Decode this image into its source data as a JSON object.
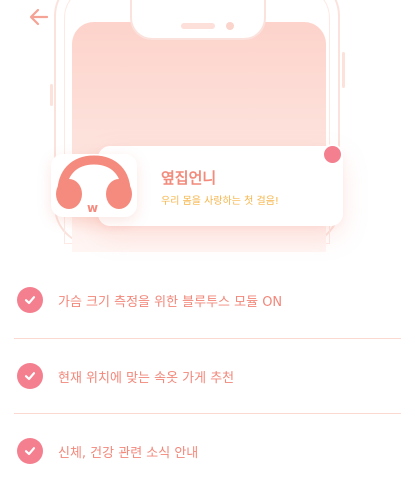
{
  "header": {
    "back_icon": "arrow-left-icon"
  },
  "app_card": {
    "title": "옆집언니",
    "subtitle": "우리 몸을 사랑하는 첫 걸음!",
    "icon": "headphones-logo-icon"
  },
  "features": [
    {
      "label": "가슴 크기 측정을 위한 블루투스 모듈 ON"
    },
    {
      "label": "현재 위치에 맞는 속옷 가게 추천"
    },
    {
      "label": "신체, 건강 관련 소식 안내"
    }
  ],
  "colors": {
    "accent": "#f47f8f",
    "text": "#f2877a",
    "subtitle": "#f6b54a",
    "divider": "#fbd8d0"
  }
}
